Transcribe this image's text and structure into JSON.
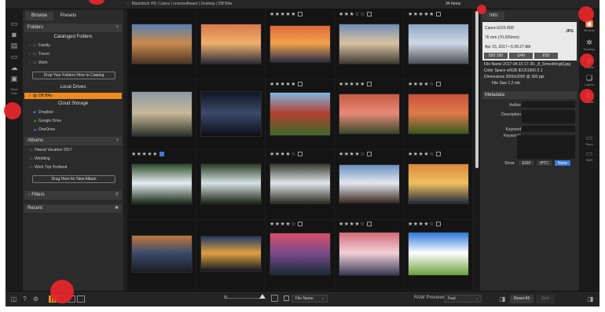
{
  "topbar": {
    "path": "Macintosh HD | Users | onsmsoftware | Desktop | DB BAs",
    "items_count": "34 Items"
  },
  "rail": {
    "label_line1": "Short",
    "label_line2": "cuts"
  },
  "left_panel": {
    "tabs": [
      "Browse",
      "Presets"
    ],
    "folders": {
      "title": "Folders",
      "cataloged_title": "Cataloged Folders",
      "items": [
        "Family",
        "Travel",
        "Work"
      ],
      "drop_button": "Drop Your Folders Here to Catalog",
      "local_drives_title": "Local Drives",
      "local_drives_items": [
        "DB BAs"
      ],
      "cloud_title": "Cloud Storage",
      "cloud_items": [
        "Dropbox",
        "Google Drive",
        "OneDrive"
      ]
    },
    "albums": {
      "title": "Albums",
      "items": [
        "Hawaii Vacation 2017",
        "Wedding",
        "Work Trip Portland"
      ],
      "drag_button": "Drag Here for New Album"
    },
    "filters_title": "Filters",
    "recent_title": "Recent"
  },
  "grid": {
    "cells": [
      {
        "stars": "",
        "checked": false,
        "colors": [
          "#5a7fb0",
          "#c98a4e",
          "#4a3526"
        ]
      },
      {
        "stars": "",
        "checked": false,
        "colors": [
          "#d8794a",
          "#f0b06a",
          "#2b2b3a"
        ]
      },
      {
        "stars": "★★★★★",
        "checked": false,
        "colors": [
          "#e0693a",
          "#f2a24c",
          "#2a2d44"
        ]
      },
      {
        "stars": "★★★☆☆",
        "checked": false,
        "colors": [
          "#6f8fb8",
          "#d9c2a0",
          "#3f3a34"
        ]
      },
      {
        "stars": "★★★★★",
        "checked": false,
        "colors": [
          "#8fa6c4",
          "#cfd8e4",
          "#4b4f55"
        ]
      },
      {
        "stars": "",
        "checked": false,
        "colors": [
          "#8a9aa6",
          "#c8b99a",
          "#2c3328"
        ]
      },
      {
        "stars": "",
        "checked": false,
        "colors": [
          "#0f1624",
          "#3b4a6c",
          "#0d0f15"
        ]
      },
      {
        "stars": "★★★★★",
        "checked": false,
        "colors": [
          "#7fb6e0",
          "#b34030",
          "#3d6a2a"
        ]
      },
      {
        "stars": "★★★★★",
        "checked": false,
        "colors": [
          "#c65a44",
          "#e88a78",
          "#3a4a2a"
        ]
      },
      {
        "stars": "★★★★☆",
        "checked": false,
        "colors": [
          "#c8523a",
          "#e07a4a",
          "#3a5a1e"
        ]
      },
      {
        "stars": "★★★★★",
        "checked": true,
        "colors": [
          "#2d4a2a",
          "#e6eef2",
          "#1a2a18"
        ]
      },
      {
        "stars": "",
        "checked": false,
        "colors": [
          "#2c3d26",
          "#d6e2e4",
          "#1b2414"
        ]
      },
      {
        "stars": "★★★★☆",
        "checked": false,
        "colors": [
          "#3b3a33",
          "#dfe6ea",
          "#2b2a24"
        ]
      },
      {
        "stars": "★★★★☆",
        "checked": false,
        "colors": [
          "#6a90c0",
          "#e4e8ee",
          "#3b2a22"
        ]
      },
      {
        "stars": "★★★★☆",
        "checked": false,
        "colors": [
          "#d98a3a",
          "#f0c060",
          "#1f2a3a"
        ]
      },
      {
        "stars": "",
        "checked": false,
        "colors": [
          "#c07840",
          "#3a4a6a",
          "#1a1d24"
        ]
      },
      {
        "stars": "",
        "checked": false,
        "colors": [
          "#233a66",
          "#e0a040",
          "#121622"
        ]
      },
      {
        "stars": "★★★★☆",
        "checked": false,
        "colors": [
          "#d9516a",
          "#7a4a8a",
          "#1a2a3a"
        ]
      },
      {
        "stars": "★★★★☆",
        "checked": false,
        "colors": [
          "#d66a7a",
          "#f0d0d8",
          "#3a3a55"
        ]
      },
      {
        "stars": "★★★★☆",
        "checked": false,
        "colors": [
          "#2d78d8",
          "#ffffff",
          "#6aa03a"
        ]
      }
    ]
  },
  "info_panel": {
    "tab": "Info",
    "camera": "Canon EOS 80D",
    "lens": "76 mm (70-200mm)",
    "date": "Apr 15, 2017 • 5:26:27 AM",
    "format": "JPG",
    "exposure": [
      "ISO 100",
      "1/40",
      "f/10"
    ],
    "file_name": "File Name 2017-04-15 17-35-_8_Smoothing6].jpg",
    "color_space": "Color Space sRGB IEC61966-2.1",
    "dimensions": "Dimensions 3000x2000 @ 300 ppi",
    "file_size": "File Size 1.2 mb",
    "metadata_title": "Metadata",
    "fields": [
      "Author",
      "Description",
      "Keyword",
      "Keywords"
    ],
    "show_label": "Show",
    "show_options": [
      "EXIF",
      "IPTC",
      "None"
    ]
  },
  "right_rail": {
    "items": [
      "Browse",
      "Develop",
      "Effects",
      "Layers",
      "Resize"
    ],
    "bottom_items": [
      "Pano",
      "HDR"
    ]
  },
  "bottombar": {
    "sort_label": "File Name",
    "raw_label": "RAW Previews",
    "raw_value": "Fast",
    "reset_all": "Reset All",
    "sync": "Sync"
  }
}
